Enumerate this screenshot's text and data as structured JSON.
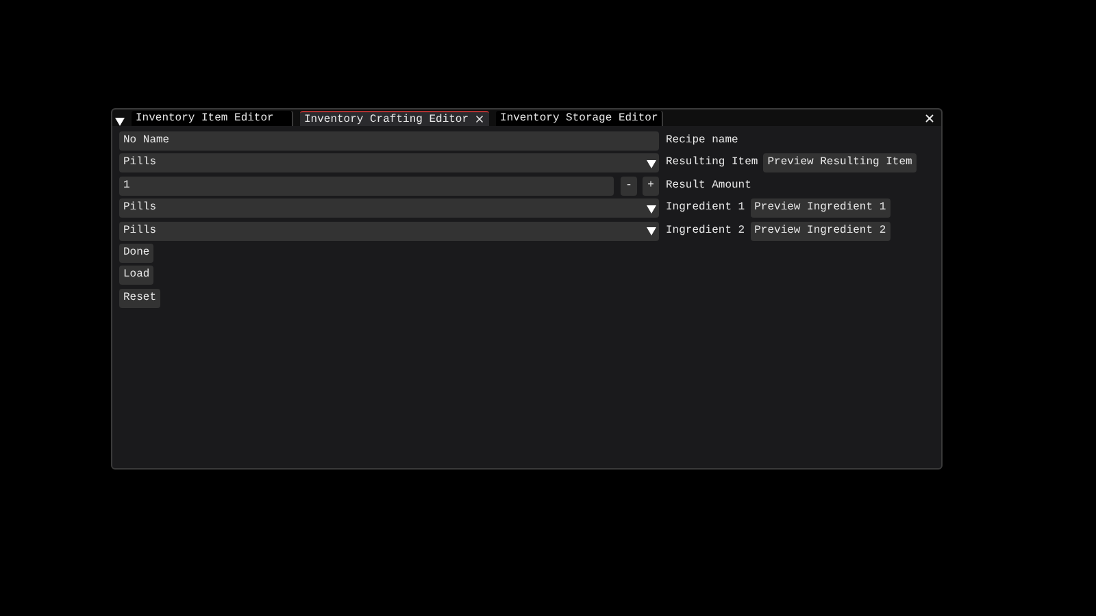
{
  "tabs": [
    {
      "label": "Inventory Item Editor",
      "selected": false
    },
    {
      "label": "Inventory Crafting Editor",
      "selected": true
    },
    {
      "label": "Inventory Storage Editor",
      "selected": false
    }
  ],
  "rows": [
    {
      "kind": "text",
      "value": "No Name",
      "label": "Recipe name"
    },
    {
      "kind": "combo",
      "value": "Pills",
      "label": "Resulting Item",
      "button": "Preview Resulting Item"
    },
    {
      "kind": "int",
      "value": "1",
      "minus": "-",
      "plus": "+",
      "label": "Result Amount"
    },
    {
      "kind": "combo",
      "value": "Pills",
      "label": "Ingredient 1",
      "button": "Preview Ingredient 1"
    },
    {
      "kind": "combo",
      "value": "Pills",
      "label": "Ingredient 2",
      "button": "Preview Ingredient 2"
    }
  ],
  "buttons": [
    "Done",
    "Load",
    "Reset"
  ]
}
